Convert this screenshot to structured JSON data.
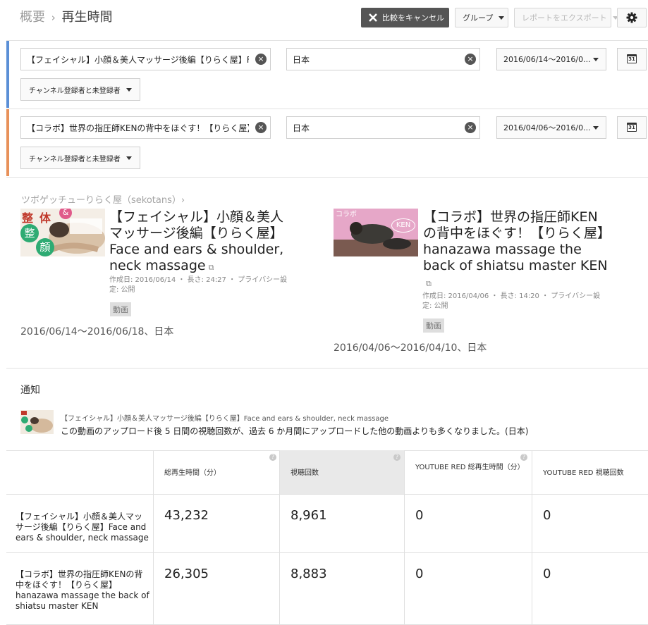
{
  "header": {
    "breadcrumb_parent": "概要",
    "breadcrumb_sep": "›",
    "breadcrumb_current": "再生時間",
    "cancel_compare_label": "比較をキャンセル",
    "group_label": "グループ",
    "export_label": "レポートをエクスポート"
  },
  "compare_rows": [
    {
      "accent_color": "#5b8fd6",
      "video": "【フェイシャル】小顔＆美人マッサージ後編【りらく屋】Face",
      "country": "日本",
      "date_range": "2016/06/14～2016/0...",
      "calendar_num": "31",
      "subscriber": "チャンネル登録者と未登録者"
    },
    {
      "accent_color": "#e8915a",
      "video": "【コラボ】世界の指圧師KENの背中をほぐす！【りらく屋】h",
      "country": "日本",
      "date_range": "2016/04/06～2016/0...",
      "calendar_num": "31",
      "subscriber": "チャンネル登録者と未登録者"
    }
  ],
  "channel_link": "ツボゲッチューりらく屋（sekotans）›",
  "videos": [
    {
      "title": "【フェイシャル】小顔＆美人マッサージ後編【りらく屋】Face and ears & shoulder, neck massage",
      "meta": "作成日: 2016/06/14 ・ 長さ: 24:27 ・ プライバシー設定: 公開",
      "tag": "動画",
      "range": "2016/06/14～2016/06/18、日本",
      "thumb_chars": [
        "整",
        "体",
        "&",
        "整",
        "顔"
      ]
    },
    {
      "title": "【コラボ】世界の指圧師KENの背中をほぐす！【りらく屋】hanazawa massage the back of shiatsu master KEN",
      "meta": "作成日: 2016/04/06 ・ 長さ: 14:20 ・ プライバシー設定: 公開",
      "tag": "動画",
      "range": "2016/04/06～2016/04/10、日本",
      "thumb_chars": [
        "コラボ",
        "KEN"
      ]
    }
  ],
  "notifications": {
    "heading": "通知",
    "title": "【フェイシャル】小顔＆美人マッサージ後編【りらく屋】Face and ears & shoulder, neck massage",
    "message": "この動画のアップロード後 5 日間の視聴回数が、過去 6 か月間にアップロードした他の動画よりも多くなりました。(日本)"
  },
  "table": {
    "headers": [
      "総再生時間（分）",
      "視聴回数",
      "YOUTUBE RED 総再生時間（分）",
      "YOUTUBE RED 視聴回数"
    ],
    "rows": [
      {
        "label": "【フェイシャル】小顔＆美人マッサージ後編【りらく屋】Face and ears & shoulder, neck massage",
        "values": [
          "43,232",
          "8,961",
          "0",
          "0"
        ]
      },
      {
        "label": "【コラボ】世界の指圧師KENの背中をほぐす！【りらく屋】hanazawa massage the back of shiatsu master KEN",
        "values": [
          "26,305",
          "8,883",
          "0",
          "0"
        ]
      }
    ],
    "help_glyph": "?"
  }
}
